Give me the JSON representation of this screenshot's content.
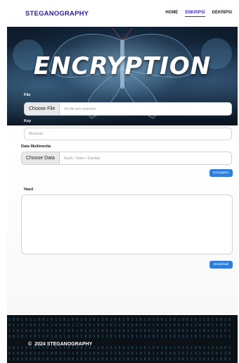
{
  "navbar": {
    "brand": "STEGANOGRAPHY",
    "links": [
      {
        "label": "HOME",
        "active": false
      },
      {
        "label": "ENKRIPSI",
        "active": true
      },
      {
        "label": "DEKRIPSI",
        "active": false
      }
    ]
  },
  "hero": {
    "title": "ENCRYPTION"
  },
  "form": {
    "file_label": "File",
    "file_button": "Choose File",
    "file_status": "No file was selected",
    "key_label": "Key",
    "key_placeholder": "Masukan",
    "multimedia_label": "Data Multimedia",
    "multimedia_button": "Choose Data",
    "multimedia_status": "Audio / Video / Gambar",
    "encrypt_button": "Encryption",
    "result_label": "Hasil",
    "download_button": "Download"
  },
  "footer": {
    "copyright_symbol": "©",
    "copyright_text": "2024 STEGANOGRAPHY"
  },
  "colors": {
    "brand": "#2a1aa8",
    "accent": "#3a2de0",
    "button": "#2f7fd8"
  }
}
